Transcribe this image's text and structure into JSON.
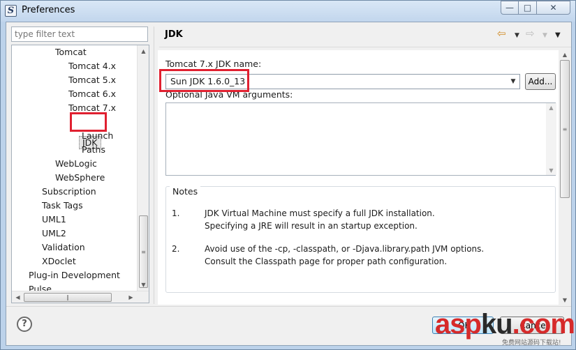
{
  "window": {
    "title": "Preferences",
    "controls": {
      "minimize": "—",
      "maximize": "□",
      "close": "✕"
    },
    "app_icon": "eclipse-app-icon"
  },
  "left": {
    "filter_placeholder": "type filter text",
    "tree": [
      {
        "label": "Tomcat",
        "level": 2
      },
      {
        "label": "Tomcat  4.x",
        "level": 3
      },
      {
        "label": "Tomcat  5.x",
        "level": 3
      },
      {
        "label": "Tomcat  6.x",
        "level": 3
      },
      {
        "label": "Tomcat  7.x",
        "level": 3
      },
      {
        "label": "JDK",
        "level": 4,
        "selected": true
      },
      {
        "label": "Launch",
        "level": 4
      },
      {
        "label": "Paths",
        "level": 4
      },
      {
        "label": "WebLogic",
        "level": 2
      },
      {
        "label": "WebSphere",
        "level": 2
      },
      {
        "label": "Subscription",
        "level": 1
      },
      {
        "label": "Task Tags",
        "level": 1
      },
      {
        "label": "UML1",
        "level": 1
      },
      {
        "label": "UML2",
        "level": 1
      },
      {
        "label": "Validation",
        "level": 1
      },
      {
        "label": "XDoclet",
        "level": 1
      },
      {
        "label": "Plug-in Development",
        "level": 0
      },
      {
        "label": "Pulse",
        "level": 0
      }
    ],
    "scroll": {
      "up": "▲",
      "down": "▼",
      "left": "◀",
      "right": "▶",
      "thumb_grip": "≡",
      "hthumb_grip": "‖"
    }
  },
  "page": {
    "title": "JDK",
    "nav": {
      "back": "⇦",
      "forward": "⇨",
      "menu": "▼"
    },
    "jdk_name_label": "Tomcat  7.x JDK name:",
    "jdk_selected": "Sun JDK 1.6.0_13",
    "add_label": "Add...",
    "vm_args_label": "Optional Java VM arguments:",
    "vm_args_value": "",
    "notes": {
      "legend": "Notes",
      "items": [
        {
          "num": "1.",
          "lines": [
            "JDK Virtual Machine must specify a full JDK installation.",
            "Specifying a JRE will result in an startup exception."
          ]
        },
        {
          "num": "2.",
          "lines": [
            "Avoid use of the -cp, -classpath, or -Djava.library.path JVM options.",
            "Consult the Classpath page for proper path configuration."
          ]
        }
      ]
    }
  },
  "buttons": {
    "help": "?",
    "ok": "OK",
    "cancel": "Cancel"
  },
  "watermark": {
    "text_a": "asp",
    "text_b": "ku",
    "text_c": ".com",
    "sub": "免费网站源码下载站!"
  },
  "colors": {
    "highlight": "#e02030",
    "window_frame": "#bcd2ea",
    "ok_border": "#3c7fb1"
  }
}
